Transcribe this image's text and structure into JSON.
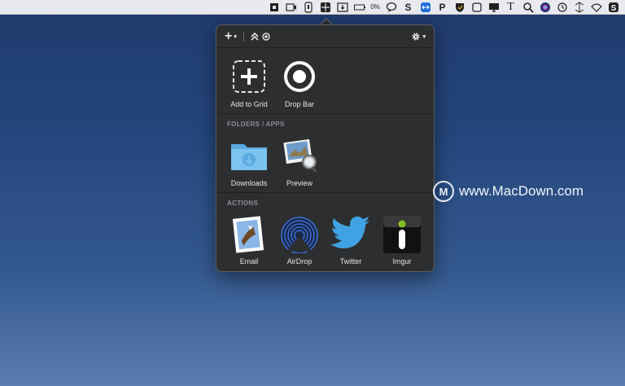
{
  "menubar": {
    "battery_percent": "0%",
    "icons": [
      "square-icon",
      "video-icon",
      "mic-icon",
      "grid-icon",
      "download-icon",
      "battery-icon",
      "bubble-icon",
      "s-app-icon",
      "teamviewer-icon",
      "pin-icon",
      "shield-icon",
      "window-icon",
      "display-icon",
      "t-font-icon",
      "search-icon",
      "siri-icon",
      "time-machine-icon",
      "airplay-icon",
      "wifi-icon",
      "s-badge-icon"
    ],
    "text_t": "T",
    "text_s": "S",
    "text_p": "P"
  },
  "toolbar": {
    "add_label": "+",
    "dropbar_glyph": "≈",
    "settings_glyph": "✲",
    "caret": "▾"
  },
  "grid_section": {
    "items": [
      {
        "label": "Add to Grid"
      },
      {
        "label": "Drop Bar"
      }
    ]
  },
  "folders_section": {
    "title": "FOLDERS / APPS",
    "items": [
      {
        "label": "Downloads"
      },
      {
        "label": "Preview"
      }
    ]
  },
  "actions_section": {
    "title": "ACTIONS",
    "items": [
      {
        "label": "Email"
      },
      {
        "label": "AirDrop"
      },
      {
        "label": "Twitter"
      },
      {
        "label": "Imgur"
      }
    ]
  },
  "watermark": {
    "logo_letter": "M",
    "text": "www.MacDown.com"
  },
  "colors": {
    "popover_bg": "#2d2e30",
    "folder_blue": "#6fb6e8",
    "twitter_blue": "#3fa2e2",
    "airdrop_blue": "#3a6fd6"
  }
}
